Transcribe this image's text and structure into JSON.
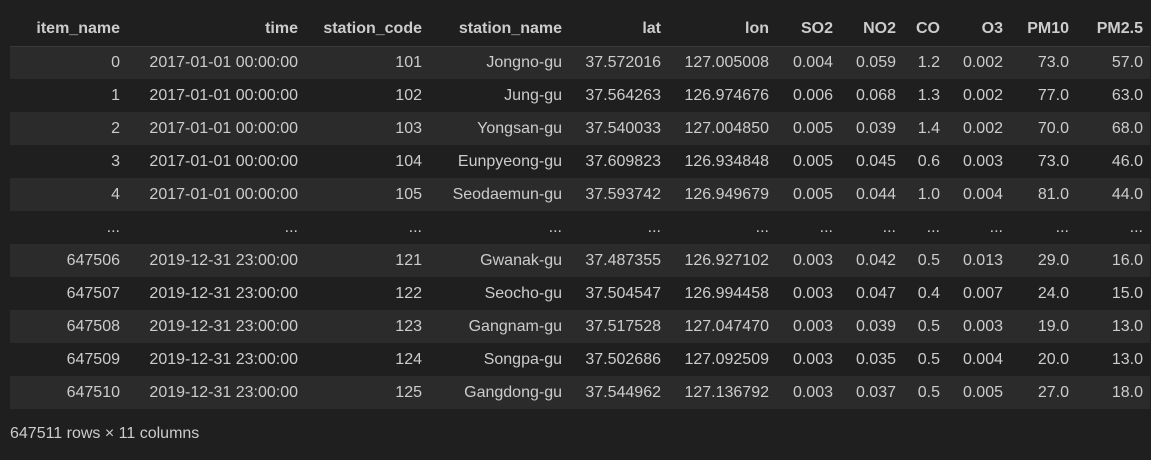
{
  "columns": [
    "item_name",
    "time",
    "station_code",
    "station_name",
    "lat",
    "lon",
    "SO2",
    "NO2",
    "CO",
    "O3",
    "PM10",
    "PM2.5"
  ],
  "rows": [
    [
      "0",
      "2017-01-01 00:00:00",
      "101",
      "Jongno-gu",
      "37.572016",
      "127.005008",
      "0.004",
      "0.059",
      "1.2",
      "0.002",
      "73.0",
      "57.0"
    ],
    [
      "1",
      "2017-01-01 00:00:00",
      "102",
      "Jung-gu",
      "37.564263",
      "126.974676",
      "0.006",
      "0.068",
      "1.3",
      "0.002",
      "77.0",
      "63.0"
    ],
    [
      "2",
      "2017-01-01 00:00:00",
      "103",
      "Yongsan-gu",
      "37.540033",
      "127.004850",
      "0.005",
      "0.039",
      "1.4",
      "0.002",
      "70.0",
      "68.0"
    ],
    [
      "3",
      "2017-01-01 00:00:00",
      "104",
      "Eunpyeong-gu",
      "37.609823",
      "126.934848",
      "0.005",
      "0.045",
      "0.6",
      "0.003",
      "73.0",
      "46.0"
    ],
    [
      "4",
      "2017-01-01 00:00:00",
      "105",
      "Seodaemun-gu",
      "37.593742",
      "126.949679",
      "0.005",
      "0.044",
      "1.0",
      "0.004",
      "81.0",
      "44.0"
    ],
    [
      "...",
      "...",
      "...",
      "...",
      "...",
      "...",
      "...",
      "...",
      "...",
      "...",
      "...",
      "..."
    ],
    [
      "647506",
      "2019-12-31 23:00:00",
      "121",
      "Gwanak-gu",
      "37.487355",
      "126.927102",
      "0.003",
      "0.042",
      "0.5",
      "0.013",
      "29.0",
      "16.0"
    ],
    [
      "647507",
      "2019-12-31 23:00:00",
      "122",
      "Seocho-gu",
      "37.504547",
      "126.994458",
      "0.003",
      "0.047",
      "0.4",
      "0.007",
      "24.0",
      "15.0"
    ],
    [
      "647508",
      "2019-12-31 23:00:00",
      "123",
      "Gangnam-gu",
      "37.517528",
      "127.047470",
      "0.003",
      "0.039",
      "0.5",
      "0.003",
      "19.0",
      "13.0"
    ],
    [
      "647509",
      "2019-12-31 23:00:00",
      "124",
      "Songpa-gu",
      "37.502686",
      "127.092509",
      "0.003",
      "0.035",
      "0.5",
      "0.004",
      "20.0",
      "13.0"
    ],
    [
      "647510",
      "2019-12-31 23:00:00",
      "125",
      "Gangdong-gu",
      "37.544962",
      "127.136792",
      "0.003",
      "0.037",
      "0.5",
      "0.005",
      "27.0",
      "18.0"
    ]
  ],
  "footer": "647511 rows × 11 columns",
  "colors": {
    "background": "#1f1f1f",
    "row_stripe": "#2b2b2b",
    "text": "#cccccc"
  }
}
